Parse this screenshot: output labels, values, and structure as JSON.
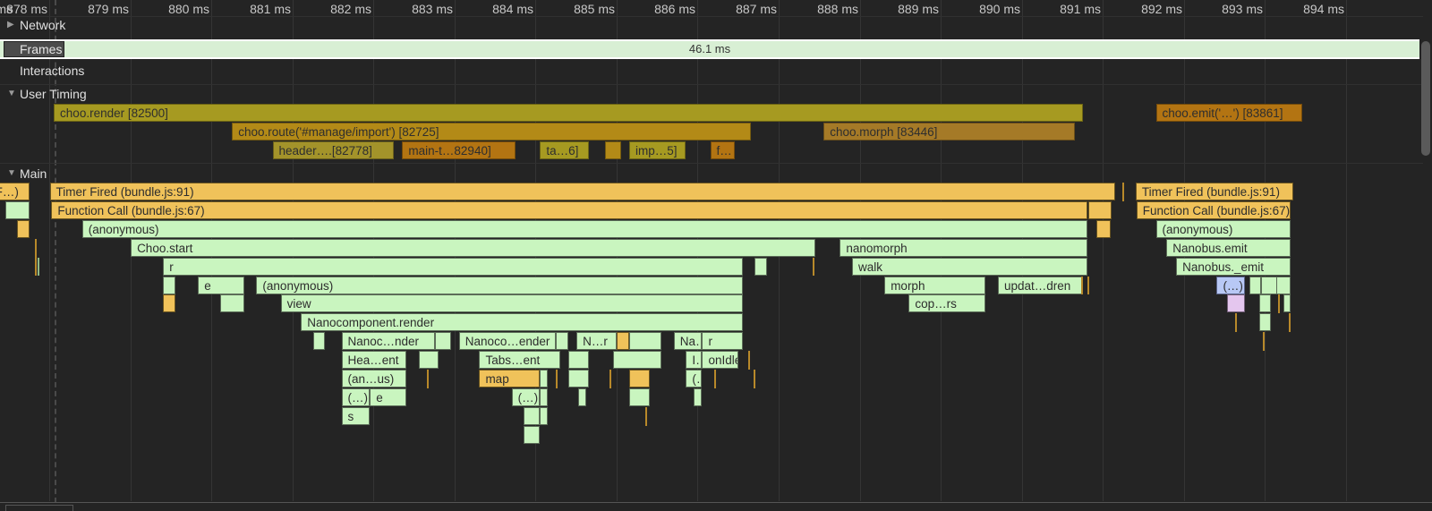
{
  "ruler": {
    "partial_left_label": "ms",
    "ticks": [
      "878 ms",
      "879 ms",
      "880 ms",
      "881 ms",
      "882 ms",
      "883 ms",
      "884 ms",
      "885 ms",
      "886 ms",
      "887 ms",
      "888 ms",
      "889 ms",
      "890 ms",
      "891 ms",
      "892 ms",
      "893 ms",
      "894 ms"
    ]
  },
  "tracks": {
    "network": {
      "label": "Network",
      "expanded": false
    },
    "frames": {
      "label": "Frames",
      "duration": "46.1 ms"
    },
    "interactions": {
      "label": "Interactions"
    },
    "user_timing": {
      "label": "User Timing",
      "expanded": true
    },
    "main": {
      "label": "Main",
      "expanded": true
    }
  },
  "user_timing_marks": [
    {
      "label": "choo.render [82500]",
      "color": "#a69a21",
      "start_ms": 878.1,
      "end_ms": 890.8
    },
    {
      "label": "choo.route('#manage/import') [82725]",
      "color": "#b38a17",
      "start_ms": 880.3,
      "end_ms": 886.7
    },
    {
      "label": "choo.morph [83446]",
      "color": "#a57a27",
      "start_ms": 887.6,
      "end_ms": 890.7
    },
    {
      "label": "choo.emit('…') [83861]",
      "color": "#b37412",
      "start_ms": 891.7,
      "end_ms": 893.5
    },
    {
      "label": "header….[82778]",
      "color": "#a3932a",
      "start_ms": 880.8,
      "end_ms": 882.3
    },
    {
      "label": "main-t…82940]",
      "color": "#b37412",
      "start_ms": 882.4,
      "end_ms": 883.8
    },
    {
      "label": "ta…6]",
      "color": "#a69a21",
      "start_ms": 884.1,
      "end_ms": 884.7
    },
    {
      "label": "",
      "color": "#b38a17",
      "start_ms": 884.9,
      "end_ms": 885.1
    },
    {
      "label": "imp…5]",
      "color": "#a69a21",
      "start_ms": 885.2,
      "end_ms": 885.9
    },
    {
      "label": "f…",
      "color": "#b37412",
      "start_ms": 886.2,
      "end_ms": 886.5
    }
  ],
  "main_blocks": [
    {
      "label": "F…)",
      "type": "task",
      "depth": 0,
      "start_ms": 877.3,
      "end_ms": 877.8
    },
    {
      "label": "",
      "type": "js",
      "depth": 1,
      "start_ms": 877.5,
      "end_ms": 877.8
    },
    {
      "label": "",
      "type": "task",
      "depth": 2,
      "start_ms": 877.65,
      "end_ms": 877.8
    },
    {
      "label": "Timer Fired (bundle.js:91)",
      "type": "task",
      "depth": 0,
      "start_ms": 878.05,
      "end_ms": 891.2
    },
    {
      "label": "Function Call (bundle.js:67)",
      "type": "task",
      "depth": 1,
      "start_ms": 878.07,
      "end_ms": 890.85
    },
    {
      "label": "",
      "type": "task",
      "depth": 1,
      "start_ms": 890.87,
      "end_ms": 891.15
    },
    {
      "label": "",
      "type": "task",
      "depth": 2,
      "start_ms": 890.97,
      "end_ms": 891.14
    },
    {
      "label": "(anonymous)",
      "type": "js",
      "depth": 2,
      "start_ms": 878.45,
      "end_ms": 890.85
    },
    {
      "label": "Choo.start",
      "type": "js",
      "depth": 3,
      "start_ms": 879.05,
      "end_ms": 887.5
    },
    {
      "label": "nanomorph",
      "type": "js",
      "depth": 3,
      "start_ms": 887.8,
      "end_ms": 890.85
    },
    {
      "label": "r",
      "type": "js",
      "depth": 4,
      "start_ms": 879.45,
      "end_ms": 886.6
    },
    {
      "label": "",
      "type": "js",
      "depth": 4,
      "start_ms": 886.75,
      "end_ms": 886.9
    },
    {
      "label": "walk",
      "type": "js",
      "depth": 4,
      "start_ms": 887.95,
      "end_ms": 890.85
    },
    {
      "label": "",
      "type": "js",
      "depth": 5,
      "start_ms": 879.45,
      "end_ms": 879.6
    },
    {
      "label": "e",
      "type": "js",
      "depth": 5,
      "start_ms": 879.88,
      "end_ms": 880.45
    },
    {
      "label": "(anonymous)",
      "type": "js",
      "depth": 5,
      "start_ms": 880.6,
      "end_ms": 886.6
    },
    {
      "label": "morph",
      "type": "js",
      "depth": 5,
      "start_ms": 888.35,
      "end_ms": 889.6
    },
    {
      "label": "updat…dren",
      "type": "js",
      "depth": 5,
      "start_ms": 889.75,
      "end_ms": 890.8
    },
    {
      "label": "",
      "type": "task",
      "depth": 6,
      "start_ms": 879.45,
      "end_ms": 879.6
    },
    {
      "label": "",
      "type": "js",
      "depth": 6,
      "start_ms": 880.15,
      "end_ms": 880.45
    },
    {
      "label": "view",
      "type": "js",
      "depth": 6,
      "start_ms": 880.9,
      "end_ms": 886.6
    },
    {
      "label": "cop…rs",
      "type": "js",
      "depth": 6,
      "start_ms": 888.65,
      "end_ms": 889.6
    },
    {
      "label": "Nanocomponent.render",
      "type": "js",
      "depth": 7,
      "start_ms": 881.15,
      "end_ms": 886.6
    },
    {
      "label": "",
      "type": "js",
      "depth": 8,
      "start_ms": 881.3,
      "end_ms": 881.45
    },
    {
      "label": "Nanoc…nder",
      "type": "js",
      "depth": 8,
      "start_ms": 881.65,
      "end_ms": 882.8
    },
    {
      "label": "",
      "type": "js",
      "depth": 8,
      "start_ms": 882.8,
      "end_ms": 883.0
    },
    {
      "label": "Nanoco…ender",
      "type": "js",
      "depth": 8,
      "start_ms": 883.1,
      "end_ms": 884.3
    },
    {
      "label": "",
      "type": "js",
      "depth": 8,
      "start_ms": 884.3,
      "end_ms": 884.45
    },
    {
      "label": "N…r",
      "type": "js",
      "depth": 8,
      "start_ms": 884.55,
      "end_ms": 885.05
    },
    {
      "label": "",
      "type": "task",
      "depth": 8,
      "start_ms": 885.05,
      "end_ms": 885.2
    },
    {
      "label": "",
      "type": "js",
      "depth": 8,
      "start_ms": 885.2,
      "end_ms": 885.6
    },
    {
      "label": "Na…r",
      "type": "js",
      "depth": 8,
      "start_ms": 885.75,
      "end_ms": 886.1
    },
    {
      "label": "r",
      "type": "js",
      "depth": 8,
      "start_ms": 886.1,
      "end_ms": 886.6
    },
    {
      "label": "Hea…ent",
      "type": "js",
      "depth": 9,
      "start_ms": 881.65,
      "end_ms": 882.45
    },
    {
      "label": "",
      "type": "js",
      "depth": 9,
      "start_ms": 882.6,
      "end_ms": 882.85
    },
    {
      "label": "Tabs…ent",
      "type": "js",
      "depth": 9,
      "start_ms": 883.35,
      "end_ms": 884.35
    },
    {
      "label": "",
      "type": "js",
      "depth": 9,
      "start_ms": 884.45,
      "end_ms": 884.7
    },
    {
      "label": "",
      "type": "js",
      "depth": 9,
      "start_ms": 885.0,
      "end_ms": 885.6
    },
    {
      "label": "I…t",
      "type": "js",
      "depth": 9,
      "start_ms": 885.9,
      "end_ms": 886.1
    },
    {
      "label": "onIdle",
      "type": "js",
      "depth": 9,
      "start_ms": 886.1,
      "end_ms": 886.55
    },
    {
      "label": "(an…us)",
      "type": "js",
      "depth": 10,
      "start_ms": 881.65,
      "end_ms": 882.45
    },
    {
      "label": "map",
      "type": "task",
      "depth": 10,
      "start_ms": 883.35,
      "end_ms": 884.1
    },
    {
      "label": "",
      "type": "js",
      "depth": 10,
      "start_ms": 884.1,
      "end_ms": 884.2
    },
    {
      "label": "",
      "type": "js",
      "depth": 10,
      "start_ms": 884.45,
      "end_ms": 884.7
    },
    {
      "label": "",
      "type": "task",
      "depth": 10,
      "start_ms": 885.2,
      "end_ms": 885.45
    },
    {
      "label": "(…)",
      "type": "js",
      "depth": 10,
      "start_ms": 885.9,
      "end_ms": 886.1
    },
    {
      "label": "(…)",
      "type": "js",
      "depth": 11,
      "start_ms": 881.65,
      "end_ms": 882.0
    },
    {
      "label": "e",
      "type": "js",
      "depth": 11,
      "start_ms": 882.0,
      "end_ms": 882.45
    },
    {
      "label": "(…)",
      "type": "js",
      "depth": 11,
      "start_ms": 883.75,
      "end_ms": 884.1
    },
    {
      "label": "",
      "type": "js",
      "depth": 11,
      "start_ms": 884.1,
      "end_ms": 884.2
    },
    {
      "label": "",
      "type": "js",
      "depth": 11,
      "start_ms": 884.57,
      "end_ms": 884.67
    },
    {
      "label": "",
      "type": "js",
      "depth": 11,
      "start_ms": 885.2,
      "end_ms": 885.45
    },
    {
      "label": "",
      "type": "js",
      "depth": 11,
      "start_ms": 886.0,
      "end_ms": 886.1
    },
    {
      "label": "s",
      "type": "js",
      "depth": 12,
      "start_ms": 881.65,
      "end_ms": 882.0
    },
    {
      "label": "",
      "type": "js",
      "depth": 12,
      "start_ms": 883.9,
      "end_ms": 884.1
    },
    {
      "label": "",
      "type": "js",
      "depth": 12,
      "start_ms": 884.1,
      "end_ms": 884.2
    },
    {
      "label": "",
      "type": "js",
      "depth": 13,
      "start_ms": 883.9,
      "end_ms": 884.1
    },
    {
      "label": "Timer Fired (bundle.js:91)",
      "type": "task",
      "depth": 0,
      "start_ms": 891.45,
      "end_ms": 893.4
    },
    {
      "label": "Function Call (bundle.js:67)",
      "type": "task",
      "depth": 1,
      "start_ms": 891.46,
      "end_ms": 893.36
    },
    {
      "label": "(anonymous)",
      "type": "js",
      "depth": 2,
      "start_ms": 891.7,
      "end_ms": 893.36
    },
    {
      "label": "Nanobus.emit",
      "type": "js",
      "depth": 3,
      "start_ms": 891.83,
      "end_ms": 893.36
    },
    {
      "label": "Nanobus._emit",
      "type": "js",
      "depth": 4,
      "start_ms": 891.95,
      "end_ms": 893.36
    },
    {
      "label": "(…)",
      "type": "blue",
      "depth": 5,
      "start_ms": 892.45,
      "end_ms": 892.8
    },
    {
      "label": "",
      "type": "js",
      "depth": 5,
      "start_ms": 892.85,
      "end_ms": 893.0
    },
    {
      "label": "",
      "type": "js",
      "depth": 5,
      "start_ms": 893.0,
      "end_ms": 893.2
    },
    {
      "label": "",
      "type": "js",
      "depth": 5,
      "start_ms": 893.18,
      "end_ms": 893.36
    },
    {
      "label": "",
      "type": "pink",
      "depth": 6,
      "start_ms": 892.58,
      "end_ms": 892.8
    },
    {
      "label": "",
      "type": "js",
      "depth": 6,
      "start_ms": 892.98,
      "end_ms": 893.12
    },
    {
      "label": "",
      "type": "js",
      "depth": 6,
      "start_ms": 893.27,
      "end_ms": 893.36
    },
    {
      "label": "",
      "type": "js",
      "depth": 7,
      "start_ms": 892.98,
      "end_ms": 893.12
    }
  ],
  "slivers": [
    {
      "ms": 877.87,
      "depth": 3,
      "rows": 2,
      "type": "task"
    },
    {
      "ms": 877.9,
      "depth": 4,
      "rows": 1,
      "type": "js"
    },
    {
      "ms": 891.28,
      "depth": 0,
      "rows": 1,
      "type": "task"
    },
    {
      "ms": 887.46,
      "depth": 4,
      "rows": 1,
      "type": "task"
    },
    {
      "ms": 890.78,
      "depth": 5,
      "rows": 1,
      "type": "task"
    },
    {
      "ms": 890.85,
      "depth": 5,
      "rows": 1,
      "type": "task"
    },
    {
      "ms": 882.7,
      "depth": 10,
      "rows": 1,
      "type": "task"
    },
    {
      "ms": 884.3,
      "depth": 10,
      "rows": 1,
      "type": "task"
    },
    {
      "ms": 884.96,
      "depth": 10,
      "rows": 1,
      "type": "task"
    },
    {
      "ms": 885.4,
      "depth": 12,
      "rows": 1,
      "type": "task"
    },
    {
      "ms": 886.25,
      "depth": 10,
      "rows": 1,
      "type": "task"
    },
    {
      "ms": 886.73,
      "depth": 10,
      "rows": 1,
      "type": "task"
    },
    {
      "ms": 886.67,
      "depth": 9,
      "rows": 1,
      "type": "task"
    },
    {
      "ms": 892.68,
      "depth": 7,
      "rows": 1,
      "type": "task"
    },
    {
      "ms": 893.02,
      "depth": 8,
      "rows": 1,
      "type": "task"
    },
    {
      "ms": 893.34,
      "depth": 7,
      "rows": 1,
      "type": "task"
    },
    {
      "ms": 893.21,
      "depth": 6,
      "rows": 1,
      "type": "task"
    }
  ]
}
